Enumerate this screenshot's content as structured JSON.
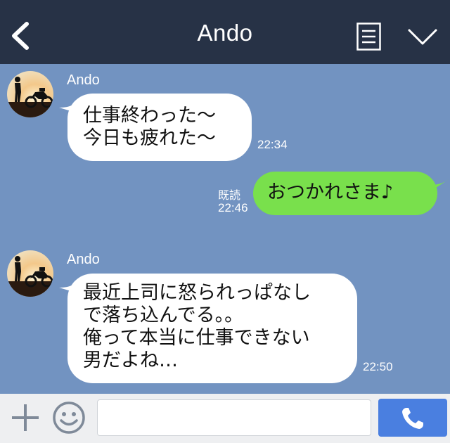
{
  "header": {
    "title": "Ando",
    "back_icon": "chevron-left-icon",
    "notes_icon": "notes-icon",
    "menu_icon": "chevron-down-icon"
  },
  "messages": [
    {
      "direction": "in",
      "sender": "Ando",
      "avatar": "motorcycle-rider-avatar",
      "text": "仕事終わった〜\n今日も疲れた〜",
      "time": "22:34"
    },
    {
      "direction": "out",
      "read_label": "既読",
      "text": "おつかれさま♪",
      "time": "22:46"
    },
    {
      "direction": "in",
      "sender": "Ando",
      "avatar": "motorcycle-rider-avatar",
      "text": "最近上司に怒られっぱなし\nで落ち込んでる。。\n俺って本当に仕事できない\n男だよね…",
      "time": "22:50"
    }
  ],
  "footer": {
    "plus_icon": "plus-icon",
    "emoji_icon": "smiley-icon",
    "input_value": "",
    "call_icon": "phone-icon"
  },
  "colors": {
    "header_bg": "#273246",
    "chat_bg": "#7293c1",
    "incoming_bubble": "#ffffff",
    "outgoing_bubble": "#79e04c",
    "call_button": "#4a7fe0"
  }
}
